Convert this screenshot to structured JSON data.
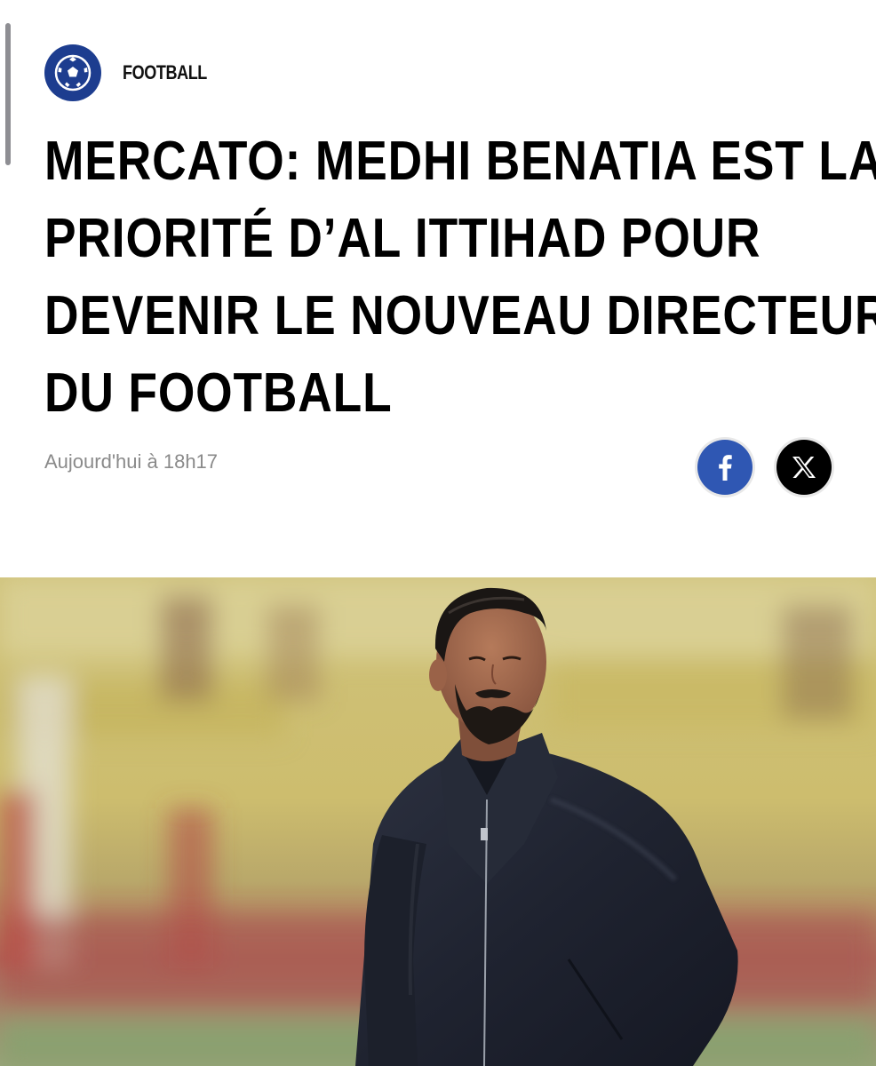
{
  "category": {
    "label": "FOOTBALL",
    "icon": "soccer-ball-icon",
    "logo_color": "#1d3d8f"
  },
  "article": {
    "headline_lines": [
      "MERCATO: MEDHI BENATIA EST LA",
      "PRIORITÉ D’AL ITTIHAD POUR",
      "DEVENIR LE NOUVEAU DIRECTEUR",
      "DU FOOTBALL"
    ],
    "timestamp": "Aujourd'hui à 18h17"
  },
  "share": {
    "facebook": {
      "icon": "facebook-icon",
      "color": "#2f57b3"
    },
    "x": {
      "icon": "x-logo-icon",
      "color": "#000000"
    }
  },
  "hero_image": {
    "subject": "man-in-navy-zip-jacket-on-stadium-pitch"
  }
}
